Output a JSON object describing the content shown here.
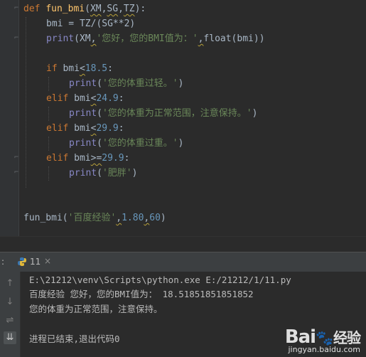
{
  "code": {
    "l1": {
      "kw": "def",
      "name": "fun_bmi",
      "open": "(",
      "p1": "XM",
      "c1": ",",
      "p2": "SG",
      "c2": ",",
      "p3": "TZ",
      "close": "):"
    },
    "l2": {
      "text": "bmi = TZ/(SG**2)"
    },
    "l3": {
      "fn": "print",
      "open": "(XM",
      "sep": ",",
      "str": "'您好，您的BMI值为：'",
      "sep2": ",",
      "rest": "float(bmi))"
    },
    "l5": {
      "kw": "if",
      "var": " bmi",
      "op": "<",
      "num": "18.5",
      "colon": ":"
    },
    "l6": {
      "fn": "print",
      "open": "(",
      "str": "'您的体重过轻。'",
      "close": ")"
    },
    "l7": {
      "kw": "elif",
      "var": " bmi",
      "op": "<",
      "num": "24.9",
      "colon": ":"
    },
    "l8": {
      "fn": "print",
      "open": "(",
      "str": "'您的体重为正常范围，注意保持。'",
      "close": ")"
    },
    "l9": {
      "kw": "elif",
      "var": " bmi",
      "op": "<",
      "num": "29.9",
      "colon": ":"
    },
    "l10": {
      "fn": "print",
      "open": "(",
      "str": "'您的体重过重。'",
      "close": ")"
    },
    "l11": {
      "kw": "elif",
      "var": " bmi",
      "op": ">=",
      "num": "29.9",
      "colon": ":"
    },
    "l12": {
      "fn": "print",
      "open": "(",
      "str": "'肥胖'",
      "close": ")"
    },
    "l15": {
      "name": "fun_bmi",
      "open": "(",
      "str": "'百度经验'",
      "sep": ",",
      "n1": "1.80",
      "sep2": ",",
      "n2": "60",
      "close": ")"
    }
  },
  "run": {
    "label": ":",
    "tab": "11",
    "close": "×"
  },
  "console": {
    "cmd": "E:\\21212\\venv\\Scripts\\python.exe E:/21212/1/11.py",
    "out1": "百度经验 您好，您的BMI值为： 18.51851851851852",
    "out2": "您的体重为正常范围，注意保持。",
    "exit": "进程已结束,退出代码0"
  },
  "watermark": {
    "brand": "Bai",
    "brand2": "经验",
    "url": "jingyan.baidu.com"
  },
  "colors": {
    "background": "#2b2b2b",
    "keyword": "#cc7832",
    "function": "#ffc66d",
    "string": "#6a8759",
    "number": "#6897bb"
  },
  "icons": [
    "python-icon",
    "up-arrow-icon",
    "down-arrow-icon",
    "soft-wrap-icon",
    "scroll-to-end-icon"
  ]
}
